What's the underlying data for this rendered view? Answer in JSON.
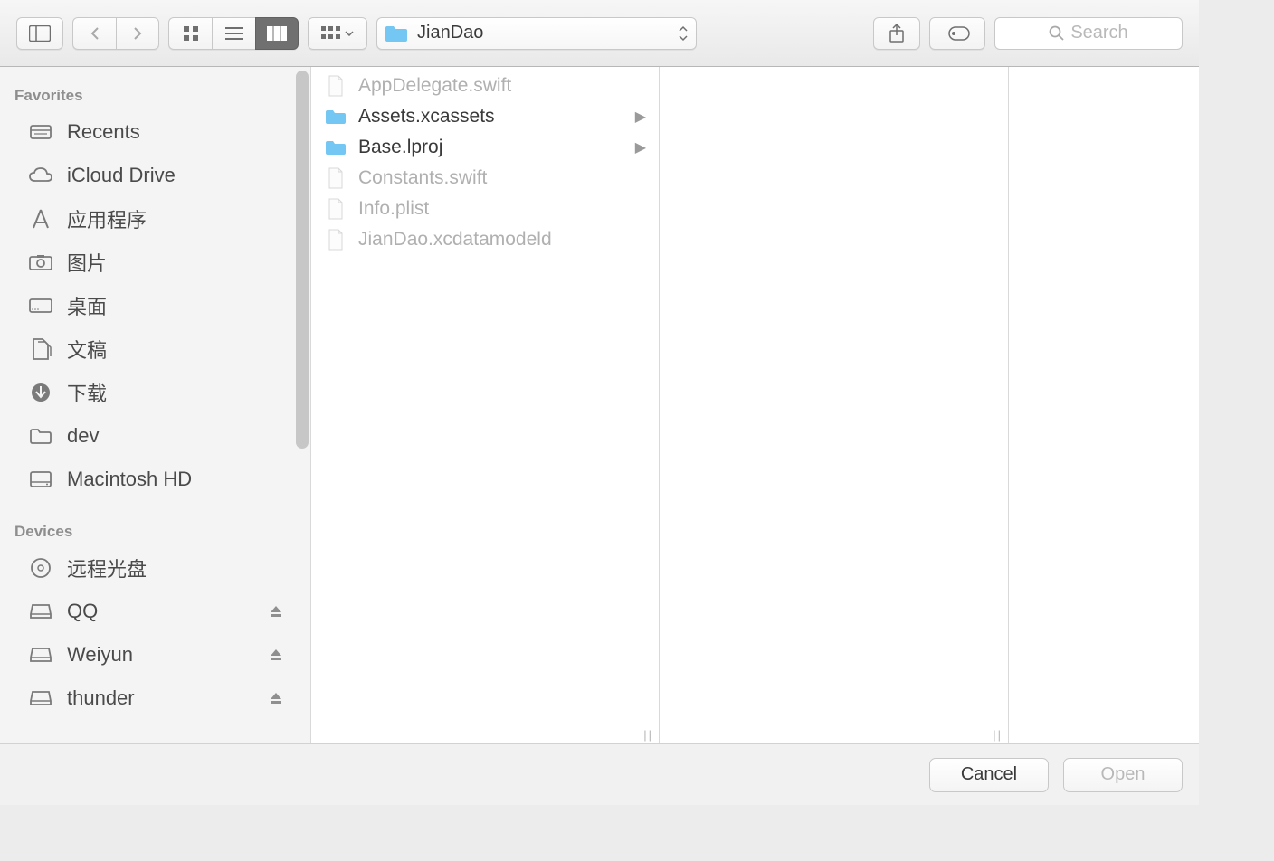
{
  "toolbar": {
    "path_label": "JianDao",
    "search_placeholder": "Search"
  },
  "sidebar": {
    "sections": [
      {
        "title": "Favorites",
        "items": [
          {
            "icon": "recents",
            "label": "Recents"
          },
          {
            "icon": "icloud",
            "label": "iCloud Drive"
          },
          {
            "icon": "apps",
            "label": "应用程序"
          },
          {
            "icon": "photos",
            "label": "图片"
          },
          {
            "icon": "desktop",
            "label": "桌面"
          },
          {
            "icon": "docs",
            "label": "文稿"
          },
          {
            "icon": "downloads",
            "label": "下载"
          },
          {
            "icon": "folder",
            "label": "dev"
          },
          {
            "icon": "hd",
            "label": "Macintosh HD"
          }
        ]
      },
      {
        "title": "Devices",
        "items": [
          {
            "icon": "disc",
            "label": "远程光盘"
          },
          {
            "icon": "drive",
            "label": "QQ",
            "eject": true
          },
          {
            "icon": "drive",
            "label": "Weiyun",
            "eject": true
          },
          {
            "icon": "drive",
            "label": "thunder",
            "eject": true
          }
        ]
      }
    ]
  },
  "files": [
    {
      "name": "AppDelegate.swift",
      "type": "swift",
      "dim": true,
      "folder": false
    },
    {
      "name": "Assets.xcassets",
      "type": "folder",
      "dim": false,
      "folder": true
    },
    {
      "name": "Base.lproj",
      "type": "folder",
      "dim": false,
      "folder": true
    },
    {
      "name": "Constants.swift",
      "type": "swift",
      "dim": true,
      "folder": false
    },
    {
      "name": "Info.plist",
      "type": "plist",
      "dim": true,
      "folder": false
    },
    {
      "name": "JianDao.xcdatamodeld",
      "type": "data",
      "dim": true,
      "folder": false
    }
  ],
  "footer": {
    "cancel": "Cancel",
    "open": "Open"
  }
}
